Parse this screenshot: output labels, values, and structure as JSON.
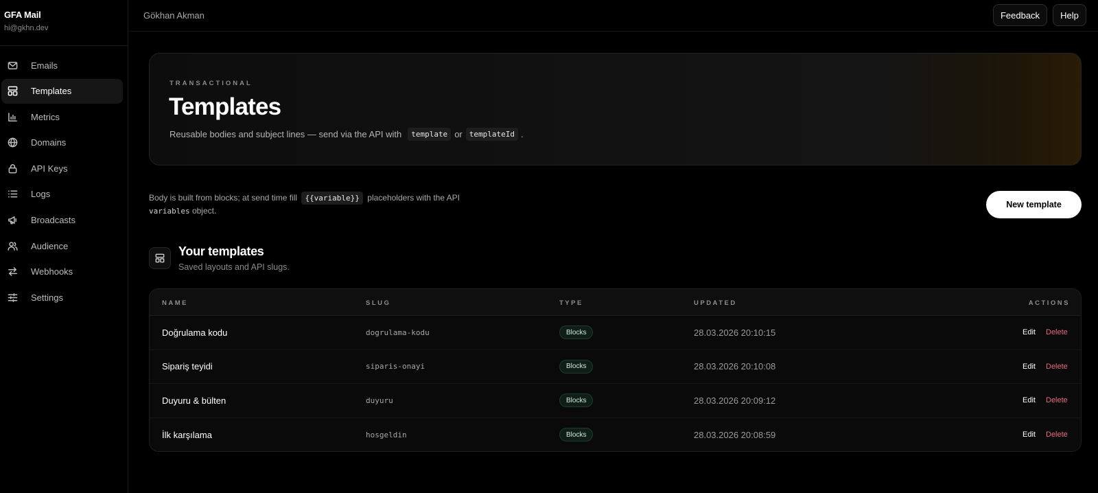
{
  "brand": {
    "name": "GFA Mail",
    "email": "hi@gkhn.dev"
  },
  "nav": {
    "items": [
      {
        "label": "Emails",
        "icon": "mail-icon"
      },
      {
        "label": "Templates",
        "icon": "layout-icon",
        "active": true
      },
      {
        "label": "Metrics",
        "icon": "bar-chart-icon"
      },
      {
        "label": "Domains",
        "icon": "globe-icon"
      },
      {
        "label": "API Keys",
        "icon": "lock-icon"
      },
      {
        "label": "Logs",
        "icon": "list-icon"
      },
      {
        "label": "Broadcasts",
        "icon": "megaphone-icon"
      },
      {
        "label": "Audience",
        "icon": "users-icon"
      },
      {
        "label": "Webhooks",
        "icon": "arrows-icon"
      },
      {
        "label": "Settings",
        "icon": "sliders-icon"
      }
    ]
  },
  "topbar": {
    "user": "Gökhan Akman",
    "feedback_label": "Feedback",
    "help_label": "Help"
  },
  "hero": {
    "overline": "TRANSACTIONAL",
    "title": "Templates",
    "desc_prefix": "Reusable bodies and subject lines — send via the API with",
    "code1": "template",
    "desc_or": "or",
    "code2": "templateId",
    "desc_suffix": "."
  },
  "intro": {
    "text1": "Body is built from blocks; at send time fill",
    "code": "{{variable}}",
    "text2": "placeholders with the API",
    "mono": "variables",
    "text3": "object."
  },
  "new_template_label": "New template",
  "section": {
    "title": "Your templates",
    "subtitle": "Saved layouts and API slugs."
  },
  "table": {
    "headers": {
      "name": "NAME",
      "slug": "SLUG",
      "type": "TYPE",
      "updated": "UPDATED",
      "actions": "ACTIONS"
    },
    "edit_label": "Edit",
    "delete_label": "Delete",
    "rows": [
      {
        "name": "Doğrulama kodu",
        "slug": "dogrulama-kodu",
        "type": "Blocks",
        "updated": "28.03.2026 20:10:15"
      },
      {
        "name": "Sipariş teyidi",
        "slug": "siparis-onayi",
        "type": "Blocks",
        "updated": "28.03.2026 20:10:08"
      },
      {
        "name": "Duyuru & bülten",
        "slug": "duyuru",
        "type": "Blocks",
        "updated": "28.03.2026 20:09:12"
      },
      {
        "name": "İlk karşılama",
        "slug": "hosgeldin",
        "type": "Blocks",
        "updated": "28.03.2026 20:08:59"
      }
    ]
  }
}
